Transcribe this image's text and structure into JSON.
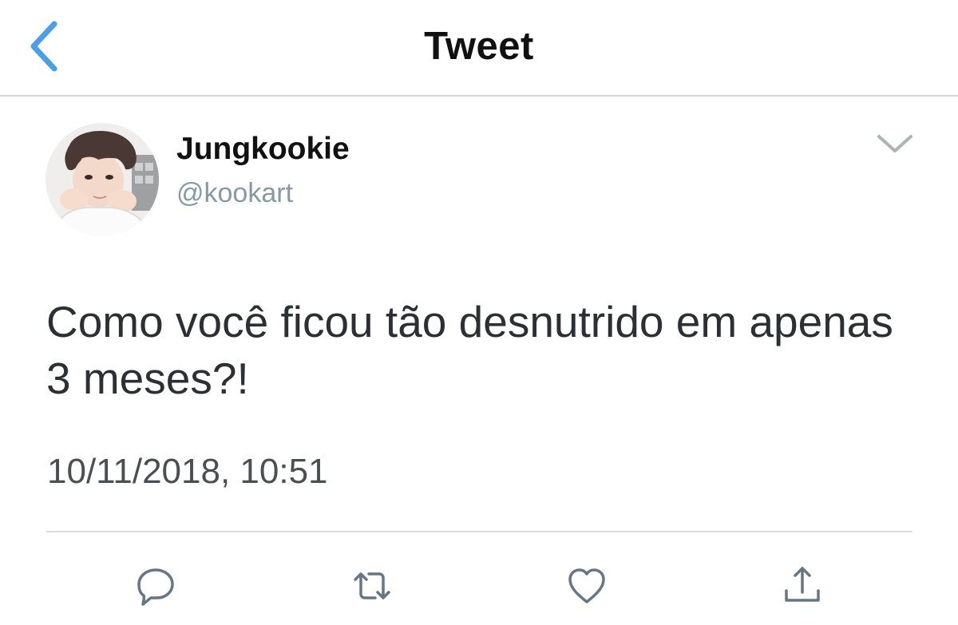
{
  "nav": {
    "title": "Tweet",
    "back_icon": "chevron-left-icon"
  },
  "author": {
    "display_name": "Jungkookie",
    "handle": "@kookart",
    "avatar_icon": "avatar-photo"
  },
  "tweet": {
    "text": "Como você ficou tão desnutrido em apenas 3 meses?!",
    "timestamp": "10/11/2018, 10:51"
  },
  "actions": [
    {
      "icon": "reply-icon"
    },
    {
      "icon": "retweet-icon"
    },
    {
      "icon": "like-icon"
    },
    {
      "icon": "share-icon"
    }
  ],
  "colors": {
    "accent": "#4a9fe8",
    "text": "#111111",
    "muted": "#8899a6",
    "icon_gray": "#657786",
    "divider": "#dcdcdc"
  }
}
